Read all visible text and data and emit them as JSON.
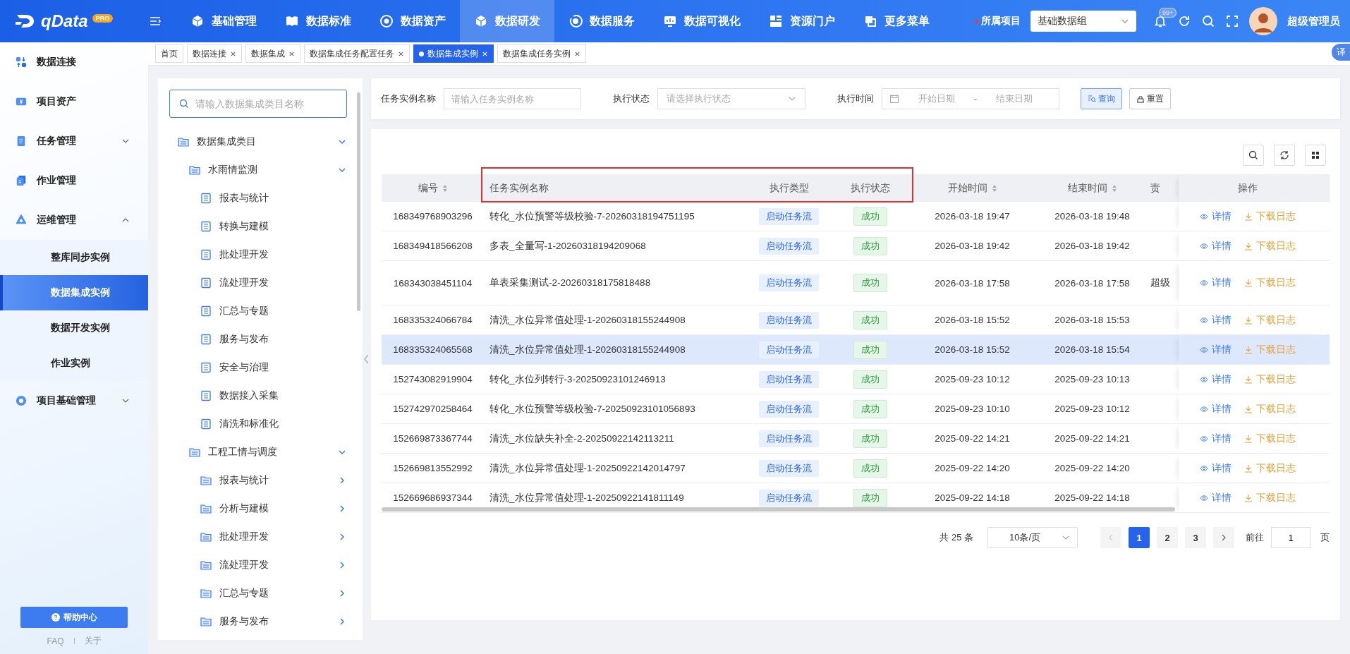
{
  "topbar": {
    "logo": "qData",
    "logo_badge": "PRO",
    "nav": [
      {
        "label": "基础管理",
        "selected": false
      },
      {
        "label": "数据标准",
        "selected": false
      },
      {
        "label": "数据资产",
        "selected": false
      },
      {
        "label": "数据研发",
        "selected": true
      },
      {
        "label": "数据服务",
        "selected": false
      },
      {
        "label": "数据可视化",
        "selected": false
      },
      {
        "label": "资源门户",
        "selected": false
      },
      {
        "label": "更多菜单",
        "selected": false
      }
    ],
    "project_label": "所属项目",
    "project_value": "基础数据组",
    "notification_count": "99+",
    "user_name": "超级管理员"
  },
  "page_tabs": [
    {
      "label": "首页",
      "selected": false,
      "closable": false
    },
    {
      "label": "数据连接",
      "selected": false,
      "closable": true
    },
    {
      "label": "数据集成",
      "selected": false,
      "closable": true
    },
    {
      "label": "数据集成任务配置任务",
      "selected": false,
      "closable": true
    },
    {
      "label": "数据集成实例",
      "selected": true,
      "closable": true
    },
    {
      "label": "数据集成任务实例",
      "selected": false,
      "closable": true
    }
  ],
  "translate_badge": "译",
  "sidebar": {
    "items": [
      {
        "label": "数据连接"
      },
      {
        "label": "项目资产"
      },
      {
        "label": "任务管理",
        "expanded": false
      },
      {
        "label": "作业管理"
      },
      {
        "label": "运维管理",
        "expanded": true,
        "children": [
          {
            "label": "整库同步实例",
            "selected": false
          },
          {
            "label": "数据集成实例",
            "selected": true
          },
          {
            "label": "数据开发实例",
            "selected": false
          },
          {
            "label": "作业实例",
            "selected": false
          }
        ]
      },
      {
        "label": "项目基础管理",
        "expanded": false
      }
    ],
    "help_button": "帮助中心",
    "footer_links": [
      "FAQ",
      "关于"
    ]
  },
  "tree": {
    "search_placeholder": "请输入数据集成类目名称",
    "items": [
      {
        "label": "数据集成类目",
        "kind": "category",
        "expanded": true,
        "children": [
          {
            "label": "水雨情监测",
            "kind": "category",
            "expanded": true,
            "children": [
              {
                "label": "报表与统计",
                "kind": "doc"
              },
              {
                "label": "转换与建模",
                "kind": "doc"
              },
              {
                "label": "批处理开发",
                "kind": "doc"
              },
              {
                "label": "流处理开发",
                "kind": "doc"
              },
              {
                "label": "汇总与专题",
                "kind": "doc"
              },
              {
                "label": "服务与发布",
                "kind": "doc"
              },
              {
                "label": "安全与治理",
                "kind": "doc"
              },
              {
                "label": "数据接入采集",
                "kind": "doc"
              },
              {
                "label": "清洗和标准化",
                "kind": "doc"
              }
            ]
          },
          {
            "label": "工程工情与调度",
            "kind": "category",
            "expanded": true,
            "children": [
              {
                "label": "报表与统计",
                "kind": "category",
                "expanded": false
              },
              {
                "label": "分析与建模",
                "kind": "category",
                "expanded": false
              },
              {
                "label": "批处理开发",
                "kind": "category",
                "expanded": false
              },
              {
                "label": "流处理开发",
                "kind": "category",
                "expanded": false
              },
              {
                "label": "汇总与专题",
                "kind": "category",
                "expanded": false
              },
              {
                "label": "服务与发布",
                "kind": "category",
                "expanded": false
              }
            ]
          }
        ]
      }
    ]
  },
  "filters": {
    "fields": [
      {
        "label": "任务实例名称",
        "kind": "text",
        "placeholder": "请输入任务实例名称"
      },
      {
        "label": "执行状态",
        "kind": "select",
        "placeholder": "请选择执行状态"
      },
      {
        "label": "执行时间",
        "kind": "daterange",
        "placeholder": "开始日期",
        "placeholder_end": "结束日期",
        "separator": "-"
      }
    ],
    "buttons": [
      {
        "label": "查询",
        "kind": "primary"
      },
      {
        "label": "重置",
        "kind": "default"
      }
    ]
  },
  "table": {
    "columns": [
      {
        "label": "编号",
        "sortable": true,
        "highlighted": false
      },
      {
        "label": "任务实例名称",
        "sortable": false,
        "highlighted": true
      },
      {
        "label": "执行类型",
        "sortable": false,
        "highlighted": true
      },
      {
        "label": "执行状态",
        "sortable": false,
        "highlighted": true
      },
      {
        "label": "开始时间",
        "sortable": true,
        "highlighted": false
      },
      {
        "label": "结束时间",
        "sortable": true,
        "highlighted": false
      },
      {
        "label": "责",
        "sortable": false,
        "highlighted": false
      },
      {
        "label": "操作",
        "sortable": false,
        "highlighted": false
      }
    ],
    "rows": [
      {
        "id": "168349768903296",
        "name": "转化_水位预警等级校验-7-20260318194751195",
        "type": "启动任务流",
        "status": "成功",
        "start": "2026-03-18 19:47",
        "end": "2026-03-18 19:48",
        "actions": [
          "详情",
          "下载日志"
        ],
        "selected": false
      },
      {
        "id": "168349418566208",
        "name": "多表_全量写-1-20260318194209068",
        "type": "启动任务流",
        "status": "成功",
        "start": "2026-03-18 19:42",
        "end": "2026-03-18 19:42",
        "actions": [
          "详情",
          "下载日志"
        ],
        "selected": false
      },
      {
        "id": "168343038451104",
        "name": "单表采集测试-2-20260318175818488",
        "type": "启动任务流",
        "status": "成功",
        "start": "2026-03-18 17:58",
        "end": "2026-03-18 17:58",
        "column_7": "超级",
        "actions": [
          "详情",
          "下载日志"
        ],
        "selected": false
      },
      {
        "id": "168335324066784",
        "name": "清洗_水位异常值处理-1-20260318155244908",
        "type": "启动任务流",
        "status": "成功",
        "start": "2026-03-18 15:52",
        "end": "2026-03-18 15:53",
        "actions": [
          "详情",
          "下载日志"
        ],
        "selected": false
      },
      {
        "id": "168335324065568",
        "name": "清洗_水位异常值处理-1-20260318155244908",
        "type": "启动任务流",
        "status": "成功",
        "start": "2026-03-18 15:52",
        "end": "2026-03-18 15:54",
        "actions": [
          "详情",
          "下载日志"
        ],
        "selected": true
      },
      {
        "id": "152743082919904",
        "name": "转化_水位列转行-3-20250923101246913",
        "type": "启动任务流",
        "status": "成功",
        "start": "2025-09-23 10:12",
        "end": "2025-09-23 10:13",
        "actions": [
          "详情",
          "下载日志"
        ],
        "selected": false
      },
      {
        "id": "152742970258464",
        "name": "转化_水位预警等级校验-7-20250923101056893",
        "type": "启动任务流",
        "status": "成功",
        "start": "2025-09-23 10:10",
        "end": "2025-09-23 10:12",
        "actions": [
          "详情",
          "下载日志"
        ],
        "selected": false
      },
      {
        "id": "152669873367744",
        "name": "清洗_水位缺失补全-2-20250922142113211",
        "type": "启动任务流",
        "status": "成功",
        "start": "2025-09-22 14:21",
        "end": "2025-09-22 14:21",
        "actions": [
          "详情",
          "下载日志"
        ],
        "selected": false
      },
      {
        "id": "152669813552992",
        "name": "清洗_水位异常值处理-1-20250922142014797",
        "type": "启动任务流",
        "status": "成功",
        "start": "2025-09-22 14:20",
        "end": "2025-09-22 14:20",
        "actions": [
          "详情",
          "下载日志"
        ],
        "selected": false
      },
      {
        "id": "152669686937344",
        "name": "清洗_水位异常值处理-1-20250922141811149",
        "type": "启动任务流",
        "status": "成功",
        "start": "2025-09-22 14:18",
        "end": "2025-09-22 14:18",
        "actions": [
          "详情",
          "下载日志"
        ],
        "selected": false
      }
    ]
  },
  "pagination": {
    "total": "共 25 条",
    "page_size": "10条/页",
    "pages": [
      {
        "label": "1",
        "selected": true
      },
      {
        "label": "2",
        "selected": false
      },
      {
        "label": "3",
        "selected": false
      }
    ],
    "goto_label": "前往",
    "goto_value": "1",
    "goto_suffix": "页"
  }
}
